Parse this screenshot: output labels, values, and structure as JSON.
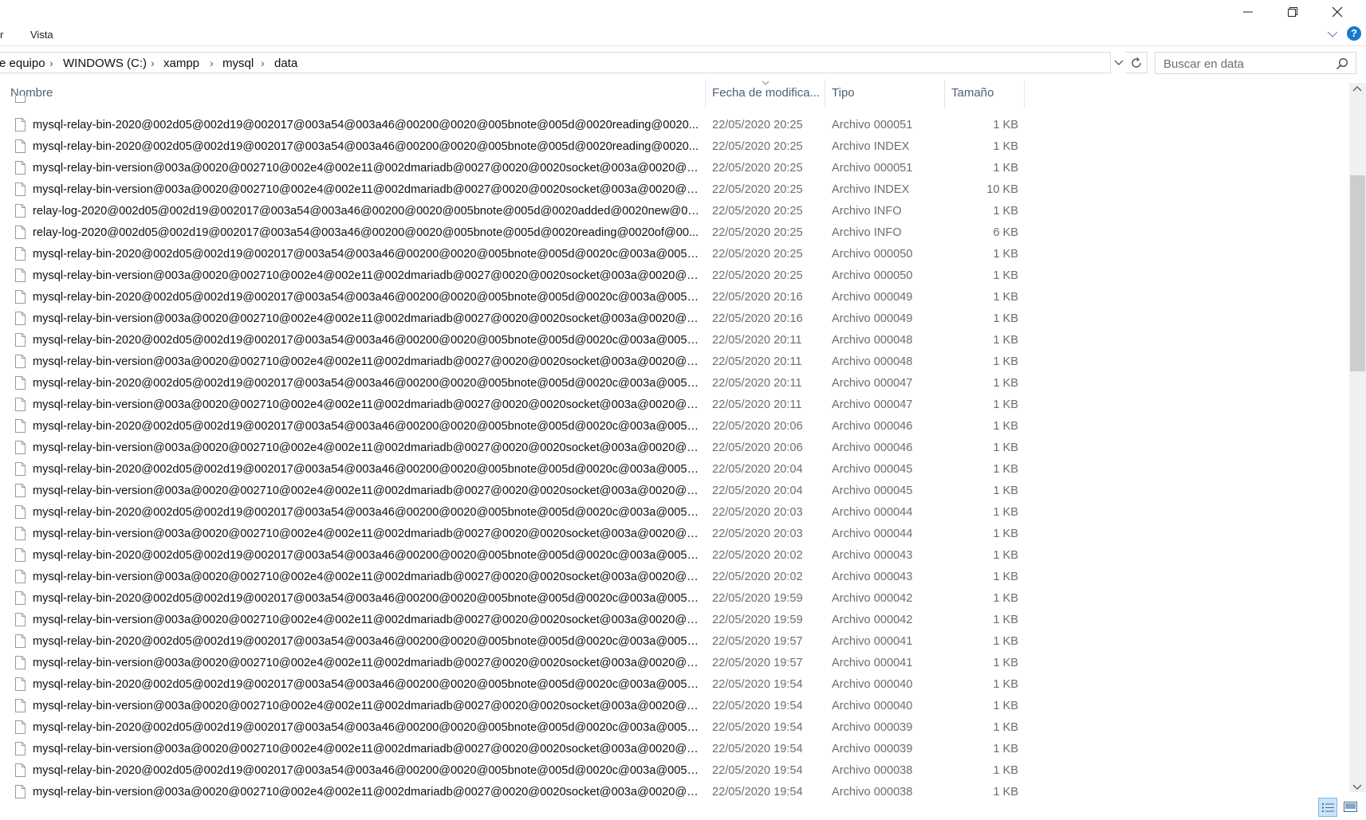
{
  "ribbon": {
    "tab_partial": "r",
    "tab_view": "Vista"
  },
  "address": {
    "crumbs": [
      "e equipo",
      "WINDOWS (C:)",
      "xampp",
      "mysql",
      "data"
    ]
  },
  "search": {
    "placeholder": "Buscar en data"
  },
  "columns": {
    "name": "Nombre",
    "date": "Fecha de modifica...",
    "type": "Tipo",
    "size": "Tamaño"
  },
  "files": [
    {
      "name": "mysql-relay-bin-2020@002d05@002d19@002017@003a54@003a46@00200@0020@005bnote@005d@0020reading@0020...",
      "date": "22/05/2020 20:25",
      "type": "Archivo 000051",
      "size": "1 KB"
    },
    {
      "name": "mysql-relay-bin-2020@002d05@002d19@002017@003a54@003a46@00200@0020@005bnote@005d@0020reading@0020...",
      "date": "22/05/2020 20:25",
      "type": "Archivo INDEX",
      "size": "1 KB"
    },
    {
      "name": "mysql-relay-bin-version@003a@0020@002710@002e4@002e11@002dmariadb@0027@0020@0020socket@003a@0020@0...",
      "date": "22/05/2020 20:25",
      "type": "Archivo 000051",
      "size": "1 KB"
    },
    {
      "name": "mysql-relay-bin-version@003a@0020@002710@002e4@002e11@002dmariadb@0027@0020@0020socket@003a@0020@0...",
      "date": "22/05/2020 20:25",
      "type": "Archivo INDEX",
      "size": "10 KB"
    },
    {
      "name": "relay-log-2020@002d05@002d19@002017@003a54@003a46@00200@0020@005bnote@005d@0020added@0020new@00...",
      "date": "22/05/2020 20:25",
      "type": "Archivo INFO",
      "size": "1 KB"
    },
    {
      "name": "relay-log-2020@002d05@002d19@002017@003a54@003a46@00200@0020@005bnote@005d@0020reading@0020of@00...",
      "date": "22/05/2020 20:25",
      "type": "Archivo INFO",
      "size": "6 KB"
    },
    {
      "name": "mysql-relay-bin-2020@002d05@002d19@002017@003a54@003a46@00200@0020@005bnote@005d@0020c@003a@005c...",
      "date": "22/05/2020 20:25",
      "type": "Archivo 000050",
      "size": "1 KB"
    },
    {
      "name": "mysql-relay-bin-version@003a@0020@002710@002e4@002e11@002dmariadb@0027@0020@0020socket@003a@0020@0...",
      "date": "22/05/2020 20:25",
      "type": "Archivo 000050",
      "size": "1 KB"
    },
    {
      "name": "mysql-relay-bin-2020@002d05@002d19@002017@003a54@003a46@00200@0020@005bnote@005d@0020c@003a@005c...",
      "date": "22/05/2020 20:16",
      "type": "Archivo 000049",
      "size": "1 KB"
    },
    {
      "name": "mysql-relay-bin-version@003a@0020@002710@002e4@002e11@002dmariadb@0027@0020@0020socket@003a@0020@0...",
      "date": "22/05/2020 20:16",
      "type": "Archivo 000049",
      "size": "1 KB"
    },
    {
      "name": "mysql-relay-bin-2020@002d05@002d19@002017@003a54@003a46@00200@0020@005bnote@005d@0020c@003a@005c...",
      "date": "22/05/2020 20:11",
      "type": "Archivo 000048",
      "size": "1 KB"
    },
    {
      "name": "mysql-relay-bin-version@003a@0020@002710@002e4@002e11@002dmariadb@0027@0020@0020socket@003a@0020@0...",
      "date": "22/05/2020 20:11",
      "type": "Archivo 000048",
      "size": "1 KB"
    },
    {
      "name": "mysql-relay-bin-2020@002d05@002d19@002017@003a54@003a46@00200@0020@005bnote@005d@0020c@003a@005c...",
      "date": "22/05/2020 20:11",
      "type": "Archivo 000047",
      "size": "1 KB"
    },
    {
      "name": "mysql-relay-bin-version@003a@0020@002710@002e4@002e11@002dmariadb@0027@0020@0020socket@003a@0020@0...",
      "date": "22/05/2020 20:11",
      "type": "Archivo 000047",
      "size": "1 KB"
    },
    {
      "name": "mysql-relay-bin-2020@002d05@002d19@002017@003a54@003a46@00200@0020@005bnote@005d@0020c@003a@005c...",
      "date": "22/05/2020 20:06",
      "type": "Archivo 000046",
      "size": "1 KB"
    },
    {
      "name": "mysql-relay-bin-version@003a@0020@002710@002e4@002e11@002dmariadb@0027@0020@0020socket@003a@0020@0...",
      "date": "22/05/2020 20:06",
      "type": "Archivo 000046",
      "size": "1 KB"
    },
    {
      "name": "mysql-relay-bin-2020@002d05@002d19@002017@003a54@003a46@00200@0020@005bnote@005d@0020c@003a@005c...",
      "date": "22/05/2020 20:04",
      "type": "Archivo 000045",
      "size": "1 KB"
    },
    {
      "name": "mysql-relay-bin-version@003a@0020@002710@002e4@002e11@002dmariadb@0027@0020@0020socket@003a@0020@0...",
      "date": "22/05/2020 20:04",
      "type": "Archivo 000045",
      "size": "1 KB"
    },
    {
      "name": "mysql-relay-bin-2020@002d05@002d19@002017@003a54@003a46@00200@0020@005bnote@005d@0020c@003a@005c...",
      "date": "22/05/2020 20:03",
      "type": "Archivo 000044",
      "size": "1 KB"
    },
    {
      "name": "mysql-relay-bin-version@003a@0020@002710@002e4@002e11@002dmariadb@0027@0020@0020socket@003a@0020@0...",
      "date": "22/05/2020 20:03",
      "type": "Archivo 000044",
      "size": "1 KB"
    },
    {
      "name": "mysql-relay-bin-2020@002d05@002d19@002017@003a54@003a46@00200@0020@005bnote@005d@0020c@003a@005c...",
      "date": "22/05/2020 20:02",
      "type": "Archivo 000043",
      "size": "1 KB"
    },
    {
      "name": "mysql-relay-bin-version@003a@0020@002710@002e4@002e11@002dmariadb@0027@0020@0020socket@003a@0020@0...",
      "date": "22/05/2020 20:02",
      "type": "Archivo 000043",
      "size": "1 KB"
    },
    {
      "name": "mysql-relay-bin-2020@002d05@002d19@002017@003a54@003a46@00200@0020@005bnote@005d@0020c@003a@005c...",
      "date": "22/05/2020 19:59",
      "type": "Archivo 000042",
      "size": "1 KB"
    },
    {
      "name": "mysql-relay-bin-version@003a@0020@002710@002e4@002e11@002dmariadb@0027@0020@0020socket@003a@0020@0...",
      "date": "22/05/2020 19:59",
      "type": "Archivo 000042",
      "size": "1 KB"
    },
    {
      "name": "mysql-relay-bin-2020@002d05@002d19@002017@003a54@003a46@00200@0020@005bnote@005d@0020c@003a@005c...",
      "date": "22/05/2020 19:57",
      "type": "Archivo 000041",
      "size": "1 KB"
    },
    {
      "name": "mysql-relay-bin-version@003a@0020@002710@002e4@002e11@002dmariadb@0027@0020@0020socket@003a@0020@0...",
      "date": "22/05/2020 19:57",
      "type": "Archivo 000041",
      "size": "1 KB"
    },
    {
      "name": "mysql-relay-bin-2020@002d05@002d19@002017@003a54@003a46@00200@0020@005bnote@005d@0020c@003a@005c...",
      "date": "22/05/2020 19:54",
      "type": "Archivo 000040",
      "size": "1 KB"
    },
    {
      "name": "mysql-relay-bin-version@003a@0020@002710@002e4@002e11@002dmariadb@0027@0020@0020socket@003a@0020@0...",
      "date": "22/05/2020 19:54",
      "type": "Archivo 000040",
      "size": "1 KB"
    },
    {
      "name": "mysql-relay-bin-2020@002d05@002d19@002017@003a54@003a46@00200@0020@005bnote@005d@0020c@003a@005c...",
      "date": "22/05/2020 19:54",
      "type": "Archivo 000039",
      "size": "1 KB"
    },
    {
      "name": "mysql-relay-bin-version@003a@0020@002710@002e4@002e11@002dmariadb@0027@0020@0020socket@003a@0020@0...",
      "date": "22/05/2020 19:54",
      "type": "Archivo 000039",
      "size": "1 KB"
    },
    {
      "name": "mysql-relay-bin-2020@002d05@002d19@002017@003a54@003a46@00200@0020@005bnote@005d@0020c@003a@005c...",
      "date": "22/05/2020 19:54",
      "type": "Archivo 000038",
      "size": "1 KB"
    },
    {
      "name": "mysql-relay-bin-version@003a@0020@002710@002e4@002e11@002dmariadb@0027@0020@0020socket@003a@0020@0...",
      "date": "22/05/2020 19:54",
      "type": "Archivo 000038",
      "size": "1 KB"
    }
  ],
  "icons": {
    "minimize": "minimize-icon",
    "restore": "restore-icon",
    "close": "close-icon",
    "help": "help-icon",
    "file": "file-icon",
    "refresh": "refresh-icon",
    "search": "search-icon",
    "chevron": "chevron-down-icon"
  },
  "colors": {
    "help_blue": "#1979ca",
    "header_text": "#4c607a",
    "secondary_text": "#6d6d6d"
  }
}
